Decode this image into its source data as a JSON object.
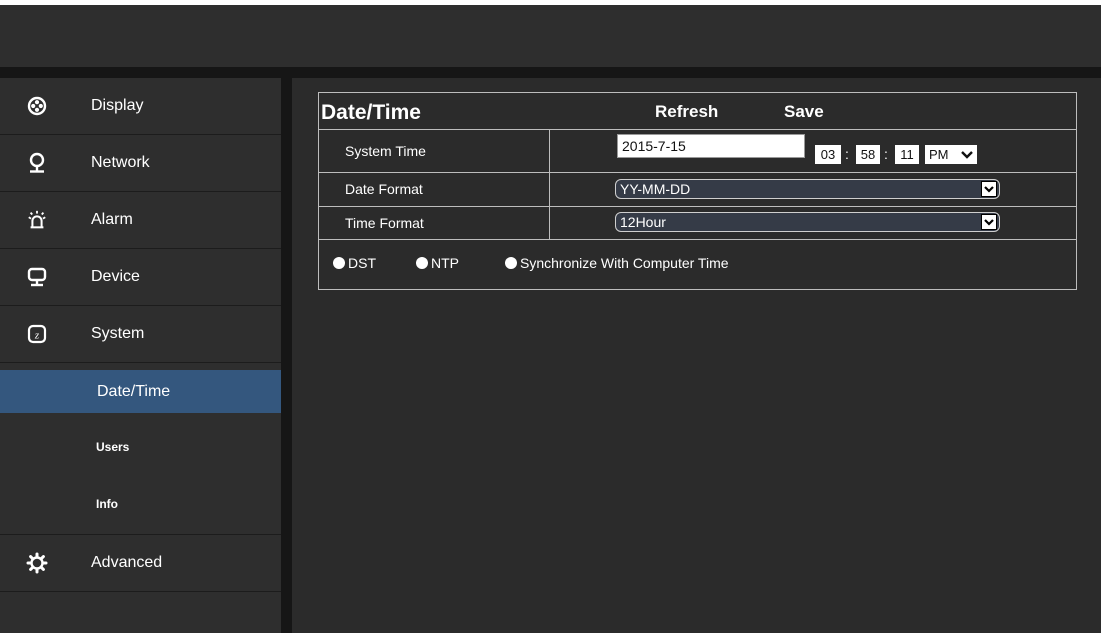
{
  "sidebar": {
    "items": [
      {
        "label": "Display",
        "icon": "display-icon"
      },
      {
        "label": "Network",
        "icon": "network-icon"
      },
      {
        "label": "Alarm",
        "icon": "alarm-icon"
      },
      {
        "label": "Device",
        "icon": "device-icon"
      },
      {
        "label": "System",
        "icon": "system-icon"
      }
    ],
    "sub_items": [
      {
        "label": "Date/Time",
        "active": true
      },
      {
        "label": "Users"
      },
      {
        "label": "Info"
      }
    ],
    "advanced": {
      "label": "Advanced",
      "icon": "gear-icon"
    }
  },
  "main": {
    "title": "Date/Time",
    "refresh_label": "Refresh",
    "save_label": "Save",
    "rows": {
      "system_time": {
        "label": "System Time",
        "date": "2015-7-15",
        "hour": "03",
        "minute": "58",
        "second": "11",
        "ampm": "PM"
      },
      "date_format": {
        "label": "Date Format",
        "value": "YY-MM-DD"
      },
      "time_format": {
        "label": "Time Format",
        "value": "12Hour"
      }
    },
    "options": {
      "dst": "DST",
      "ntp": "NTP",
      "sync": "Synchronize With Computer Time"
    },
    "time_separator": ":"
  },
  "colors": {
    "active_item": "#34577e",
    "background": "#2b2b2b"
  }
}
